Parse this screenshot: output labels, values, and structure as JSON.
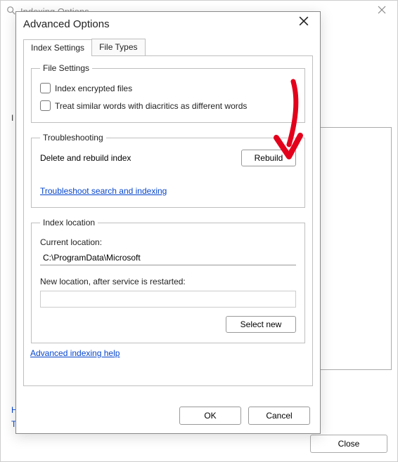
{
  "background_window": {
    "title": "Indexing Options",
    "body_label_initial": "I",
    "link1_initial": "H",
    "link2_initial": "T",
    "close_button": "Close"
  },
  "dialog": {
    "title": "Advanced Options",
    "tabs": [
      {
        "label": "Index Settings",
        "active": true
      },
      {
        "label": "File Types",
        "active": false
      }
    ],
    "file_settings": {
      "legend": "File Settings",
      "opt1": "Index encrypted files",
      "opt2": "Treat similar words with diacritics as different words"
    },
    "troubleshooting": {
      "legend": "Troubleshooting",
      "rebuild_label": "Delete and rebuild index",
      "rebuild_button": "Rebuild",
      "link": "Troubleshoot search and indexing"
    },
    "index_location": {
      "legend": "Index location",
      "current_label": "Current location:",
      "current_value": "C:\\ProgramData\\Microsoft",
      "new_label": "New location, after service is restarted:",
      "select_new_button": "Select new"
    },
    "advanced_help": "Advanced indexing help",
    "ok_button": "OK",
    "cancel_button": "Cancel"
  },
  "annotation": {
    "arrow_color": "#e3001b"
  }
}
